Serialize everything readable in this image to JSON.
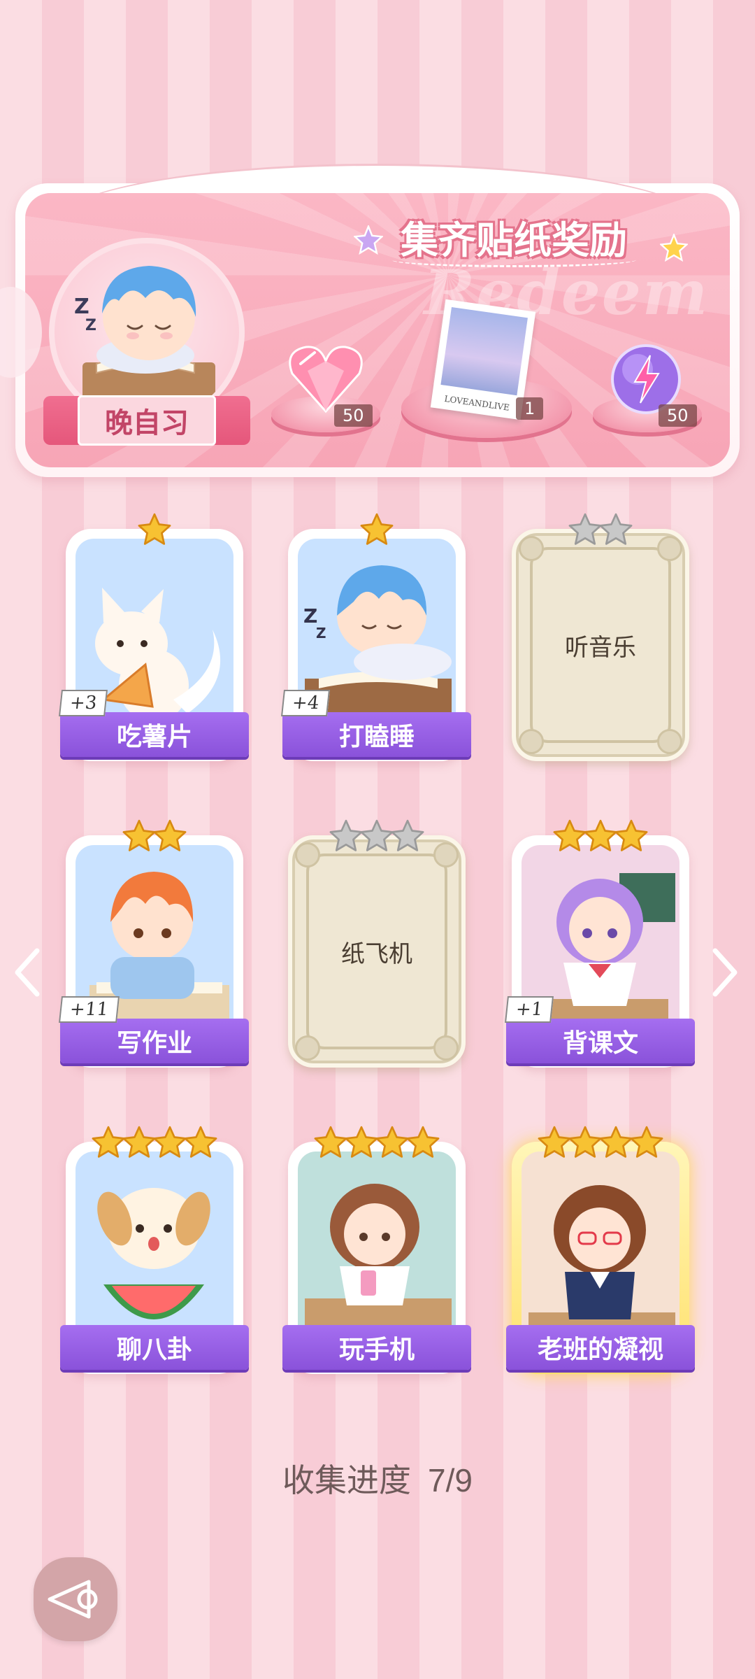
{
  "banner": {
    "title": "集齐贴纸奖励",
    "watermark": "Redeem",
    "current_sticker": "晚自习",
    "rewards": [
      {
        "icon": "heart-gem-icon",
        "count": "50"
      },
      {
        "icon": "photo-card-icon",
        "count": "1",
        "caption": "LOVEANDLIVE"
      },
      {
        "icon": "energy-orb-icon",
        "count": "50"
      }
    ]
  },
  "stickers": [
    {
      "label": "吃薯片",
      "stars": 1,
      "bonus": "+3",
      "locked": false,
      "art": "fox"
    },
    {
      "label": "打瞌睡",
      "stars": 1,
      "bonus": "+4",
      "locked": false,
      "art": "sleepy-boy"
    },
    {
      "label": "听音乐",
      "stars": 2,
      "bonus": "",
      "locked": true,
      "art": ""
    },
    {
      "label": "写作业",
      "stars": 2,
      "bonus": "+11",
      "locked": false,
      "art": "ginger-boy"
    },
    {
      "label": "纸飞机",
      "stars": 3,
      "bonus": "",
      "locked": true,
      "art": ""
    },
    {
      "label": "背课文",
      "stars": 3,
      "bonus": "+1",
      "locked": false,
      "art": "purple-girl"
    },
    {
      "label": "聊八卦",
      "stars": 4,
      "bonus": "",
      "locked": false,
      "art": "puppy"
    },
    {
      "label": "玩手机",
      "stars": 4,
      "bonus": "",
      "locked": false,
      "art": "phone-girl"
    },
    {
      "label": "老班的凝视",
      "stars": 4,
      "bonus": "",
      "locked": false,
      "art": "teacher",
      "special": true
    }
  ],
  "progress": {
    "label": "收集进度",
    "value": "7/9",
    "collected": 7,
    "total": 9
  },
  "colors": {
    "accent_purple": "#9a61e6",
    "accent_pink": "#f7a5b6",
    "star_gold": "#f7c232",
    "star_silver": "#c8c8c8"
  }
}
